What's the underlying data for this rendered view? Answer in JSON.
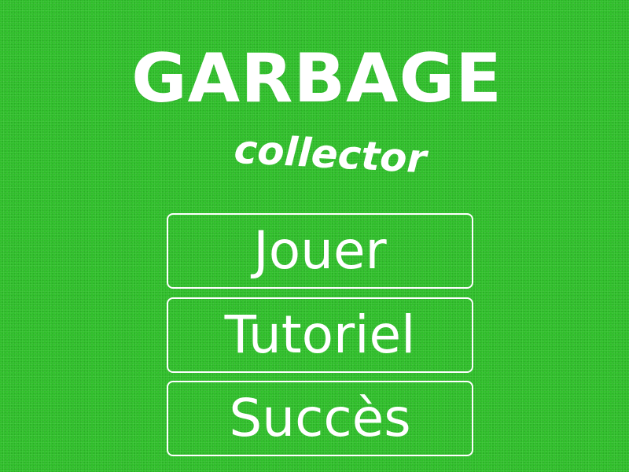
{
  "title": {
    "main": "GARBAGE",
    "sub": "collector"
  },
  "menu": {
    "items": [
      {
        "label": "Jouer"
      },
      {
        "label": "Tutoriel"
      },
      {
        "label": "Succès"
      }
    ]
  },
  "colors": {
    "background": "#2fbe2a",
    "text": "#ffffff",
    "button_border": "#ffffff"
  }
}
